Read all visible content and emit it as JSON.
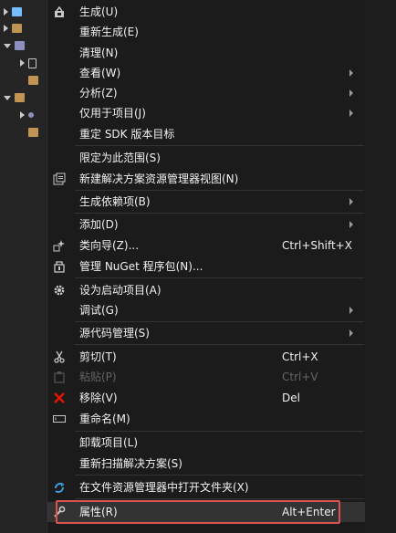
{
  "colors": {
    "menu_bg": "#1b1b1c",
    "highlight_border": "#d9534f",
    "delete_red": "#e51400",
    "refresh_blue": "#3c9adc"
  },
  "menu": {
    "items": [
      {
        "label": "生成(U)",
        "icon": "build-icon"
      },
      {
        "label": "重新生成(E)"
      },
      {
        "label": "清理(N)"
      },
      {
        "label": "查看(W)",
        "submenu": true
      },
      {
        "label": "分析(Z)",
        "submenu": true
      },
      {
        "label": "仅用于项目(J)",
        "submenu": true
      },
      {
        "label": "重定 SDK 版本目标"
      },
      {
        "label": "限定为此范围(S)"
      },
      {
        "label": "新建解决方案资源管理器视图(N)",
        "icon": "new-view-icon"
      },
      {
        "label": "生成依赖项(B)",
        "submenu": true
      },
      {
        "label": "添加(D)",
        "submenu": true
      },
      {
        "label": "类向导(Z)...",
        "shortcut": "Ctrl+Shift+X",
        "icon": "class-wizard-icon"
      },
      {
        "label": "管理 NuGet 程序包(N)...",
        "icon": "nuget-icon"
      },
      {
        "label": "设为启动项目(A)",
        "icon": "gear-icon"
      },
      {
        "label": "调试(G)",
        "submenu": true
      },
      {
        "label": "源代码管理(S)",
        "submenu": true
      },
      {
        "label": "剪切(T)",
        "shortcut": "Ctrl+X",
        "icon": "scissors-icon"
      },
      {
        "label": "粘贴(P)",
        "shortcut": "Ctrl+V",
        "icon": "paste-icon",
        "disabled": true
      },
      {
        "label": "移除(V)",
        "shortcut": "Del",
        "icon": "delete-icon"
      },
      {
        "label": "重命名(M)",
        "icon": "rename-icon"
      },
      {
        "label": "卸载项目(L)"
      },
      {
        "label": "重新扫描解决方案(S)"
      },
      {
        "label": "在文件资源管理器中打开文件夹(X)",
        "icon": "open-folder-icon"
      },
      {
        "label": "属性(R)",
        "shortcut": "Alt+Enter",
        "icon": "wrench-icon",
        "hovered": true
      }
    ]
  }
}
